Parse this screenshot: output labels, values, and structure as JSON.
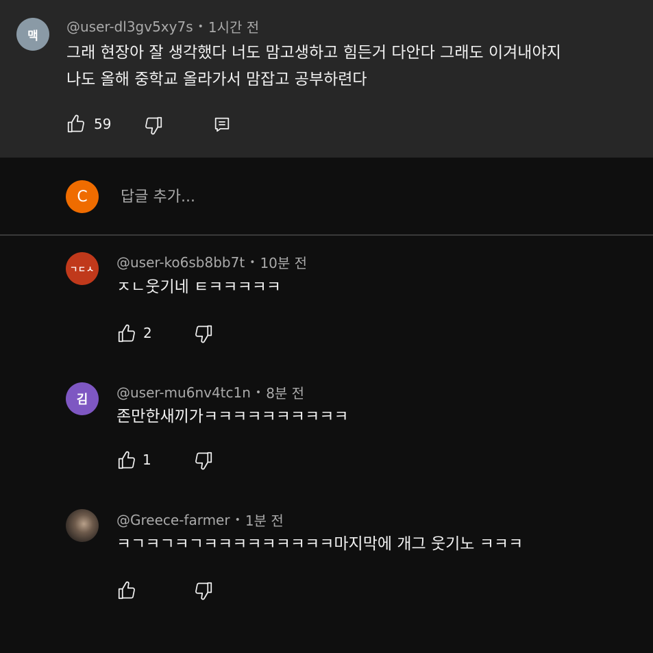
{
  "parent_comment": {
    "avatar_letter": "맥",
    "avatar_color": "#8a9aa6",
    "handle": "@user-dl3gv5xy7s",
    "time": "1시간 전",
    "lines": [
      "그래 현장아 잘 생각했다 너도 맘고생하고 힘든거 다안다 그래도 이겨내야지",
      "나도 올해 중학교 올라가서 맘잡고 공부하련다"
    ],
    "like_count": "59",
    "icons": [
      "thumbs-up-icon",
      "thumbs-down-icon",
      "reply-icon"
    ]
  },
  "reply_box": {
    "avatar_letter": "C",
    "avatar_color": "#ef6c00",
    "placeholder": "답글 추가..."
  },
  "replies": [
    {
      "avatar_letter": "ㄱㄷㅅ",
      "avatar_color": "#c0391b",
      "handle": "@user-ko6sb8bb7t",
      "time": "10분 전",
      "text": "ㅈㄴ웃기네 ㅌㅋㅋㅋㅋㅋ",
      "like_count": "2"
    },
    {
      "avatar_letter": "김",
      "avatar_color": "#7e57c2",
      "handle": "@user-mu6nv4tc1n",
      "time": "8분 전",
      "text": "존만한새끼가ㅋㅋㅋㅋㅋㅋㅋㅋㅋㅋ",
      "like_count": "1"
    },
    {
      "avatar_letter": "",
      "avatar_color": "#4a4038",
      "handle": "@Greece-farmer",
      "time": "1분 전",
      "text": "ㅋㄱㅋㄱㅋㄱㅋㅋㅋㅋㅋㅋㅋㅋㅋ마지막에 개그 웃기노 ㅋㅋㅋ",
      "like_count": ""
    }
  ]
}
